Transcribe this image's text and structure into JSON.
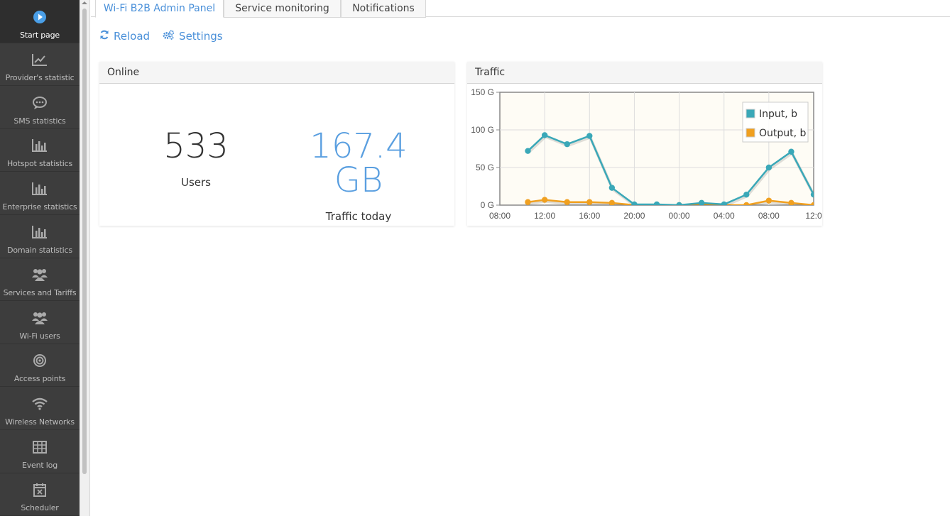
{
  "sidebar": {
    "items": [
      {
        "label": "Start page",
        "icon": "play-circle-icon"
      },
      {
        "label": "Provider's statistic",
        "icon": "line-chart-icon"
      },
      {
        "label": "SMS statistics",
        "icon": "chat-bubble-icon"
      },
      {
        "label": "Hotspot statistics",
        "icon": "bar-chart-icon"
      },
      {
        "label": "Enterprise statistics",
        "icon": "bar-chart-icon"
      },
      {
        "label": "Domain statistics",
        "icon": "bar-chart-icon"
      },
      {
        "label": "Services and Tariffs",
        "icon": "users-icon"
      },
      {
        "label": "Wi-Fi users",
        "icon": "users-icon"
      },
      {
        "label": "Access points",
        "icon": "target-icon"
      },
      {
        "label": "Wireless Networks",
        "icon": "wifi-icon"
      },
      {
        "label": "Event log",
        "icon": "table-icon"
      },
      {
        "label": "Scheduler",
        "icon": "calendar-x-icon"
      }
    ]
  },
  "tabs": [
    {
      "label": "Wi-Fi B2B Admin Panel"
    },
    {
      "label": "Service monitoring"
    },
    {
      "label": "Notifications"
    }
  ],
  "toolbar": {
    "reload_label": "Reload",
    "settings_label": "Settings"
  },
  "online": {
    "title": "Online",
    "users_value": "533",
    "users_label": "Users",
    "traffic_value": "167.4 GB",
    "traffic_label": "Traffic today"
  },
  "traffic": {
    "title": "Traffic"
  },
  "colors": {
    "accent": "#4a90d9",
    "input_series": "#3aa8b8",
    "output_series": "#f0a020",
    "sidebar_bg": "#3d3d3d"
  },
  "chart_data": {
    "type": "line",
    "x_ticks": [
      "08:00",
      "12:00",
      "16:00",
      "20:00",
      "00:00",
      "04:00",
      "08:00",
      "12:0"
    ],
    "y_ticks": [
      "0 G",
      "50 G",
      "100 G",
      "150 G"
    ],
    "ylim": [
      0,
      150
    ],
    "grid": true,
    "legend": "top-right",
    "x": [
      10.5,
      12,
      14,
      16,
      18,
      20,
      22,
      24,
      26,
      28,
      30,
      32,
      34,
      36
    ],
    "xlim": [
      8,
      36
    ],
    "series": [
      {
        "name": "Input, b",
        "color": "#3aa8b8",
        "values": [
          72,
          93,
          81,
          92,
          23,
          1,
          1,
          0,
          3,
          1,
          14,
          50,
          71,
          14
        ]
      },
      {
        "name": "Output, b",
        "color": "#f0a020",
        "values": [
          4,
          7,
          4,
          4,
          3,
          0,
          0,
          0,
          1,
          0,
          0,
          6,
          3,
          0
        ]
      }
    ]
  }
}
